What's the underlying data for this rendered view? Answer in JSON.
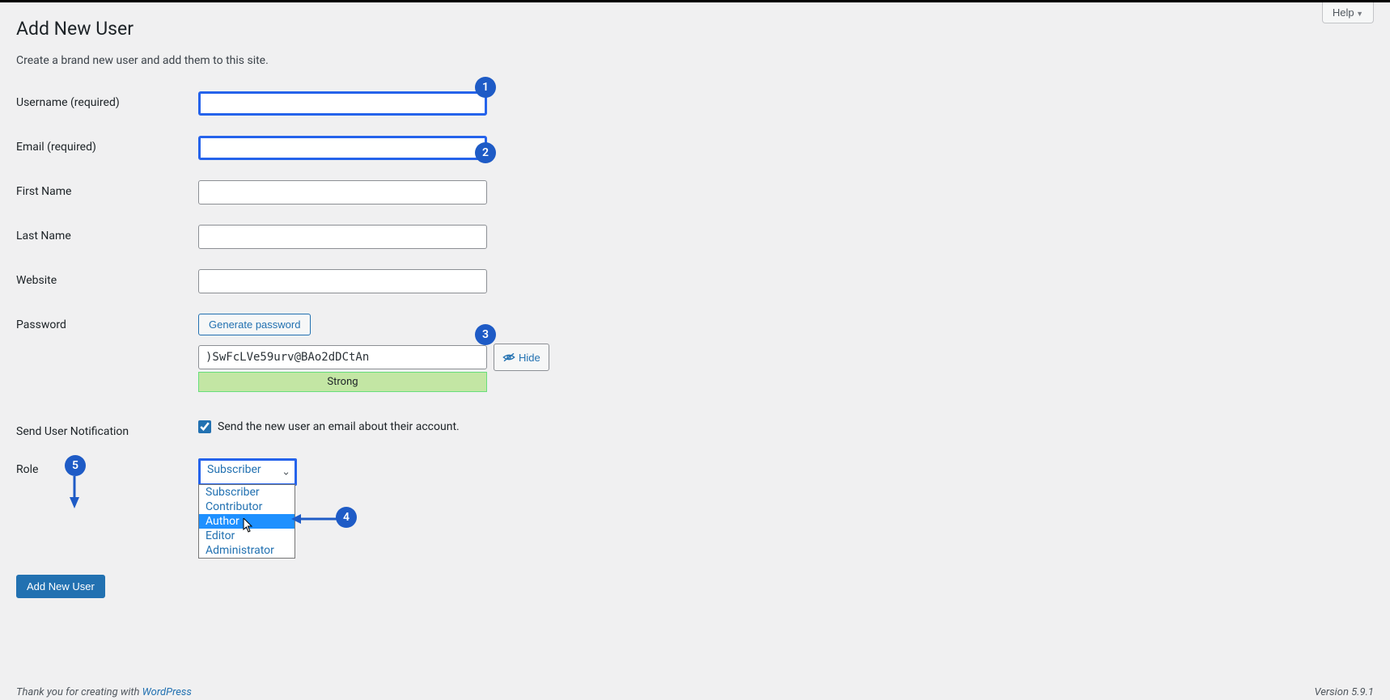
{
  "header": {
    "title": "Add New User",
    "subtitle": "Create a brand new user and add them to this site.",
    "help_label": "Help"
  },
  "form": {
    "username_label": "Username",
    "username_required": "(required)",
    "email_label": "Email",
    "email_required": "(required)",
    "firstname_label": "First Name",
    "lastname_label": "Last Name",
    "website_label": "Website",
    "password_label": "Password",
    "generate_password_label": "Generate password",
    "password_value": ")SwFcLVe59urv@BAo2dDCtAn",
    "hide_label": "Hide",
    "strength_label": "Strong",
    "notification_label": "Send User Notification",
    "notification_text": "Send the new user an email about their account.",
    "notification_checked": true,
    "role_label": "Role",
    "role_selected": "Subscriber",
    "role_options": [
      "Subscriber",
      "Contributor",
      "Author",
      "Editor",
      "Administrator"
    ],
    "role_highlighted_index": 2,
    "submit_label": "Add New User"
  },
  "badges": {
    "b1": "1",
    "b2": "2",
    "b3": "3",
    "b4": "4",
    "b5": "5"
  },
  "footer": {
    "thanks_prefix": "Thank you for creating with ",
    "thanks_link": "WordPress",
    "version": "Version 5.9.1"
  }
}
